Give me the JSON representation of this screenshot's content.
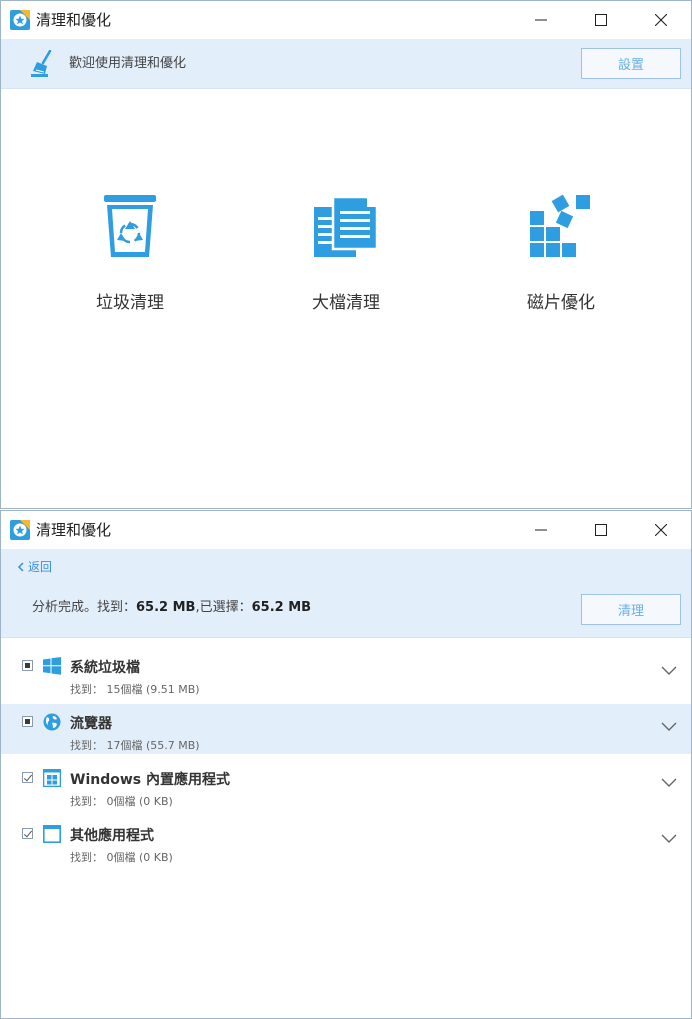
{
  "app": {
    "title": "清理和優化"
  },
  "home": {
    "welcome": "歡迎使用清理和優化",
    "settings_label": "設置",
    "tools": [
      {
        "label": "垃圾清理",
        "icon": "recycle-bin-icon"
      },
      {
        "label": "大檔清理",
        "icon": "large-files-icon"
      },
      {
        "label": "磁片優化",
        "icon": "disk-defrag-icon"
      }
    ]
  },
  "results": {
    "back_label": "返回",
    "summary": {
      "prefix": "分析完成。找到：",
      "found": "65.2 MB",
      "selected_prefix": ",已選擇：",
      "selected": "65.2 MB"
    },
    "clean_label": "清理",
    "categories": [
      {
        "name": "系統垃圾檔",
        "detail": "找到： 15個檔 (9.51 MB)",
        "icon": "windows-logo-icon",
        "check_state": "partial",
        "highlighted": false
      },
      {
        "name": "流覽器",
        "detail": "找到： 17個檔 (55.7 MB)",
        "icon": "globe-icon",
        "check_state": "partial",
        "highlighted": true
      },
      {
        "name": "Windows 內置應用程式",
        "detail": "找到： 0個檔 (0 KB)",
        "icon": "windows-app-icon",
        "check_state": "checked",
        "highlighted": false
      },
      {
        "name": "其他應用程式",
        "detail": "找到： 0個檔 (0 KB)",
        "icon": "app-window-icon",
        "check_state": "checked",
        "highlighted": false
      }
    ]
  },
  "colors": {
    "accent": "#2f9ee0",
    "banner": "#e3eefb",
    "button_border": "#9ec3e6"
  }
}
